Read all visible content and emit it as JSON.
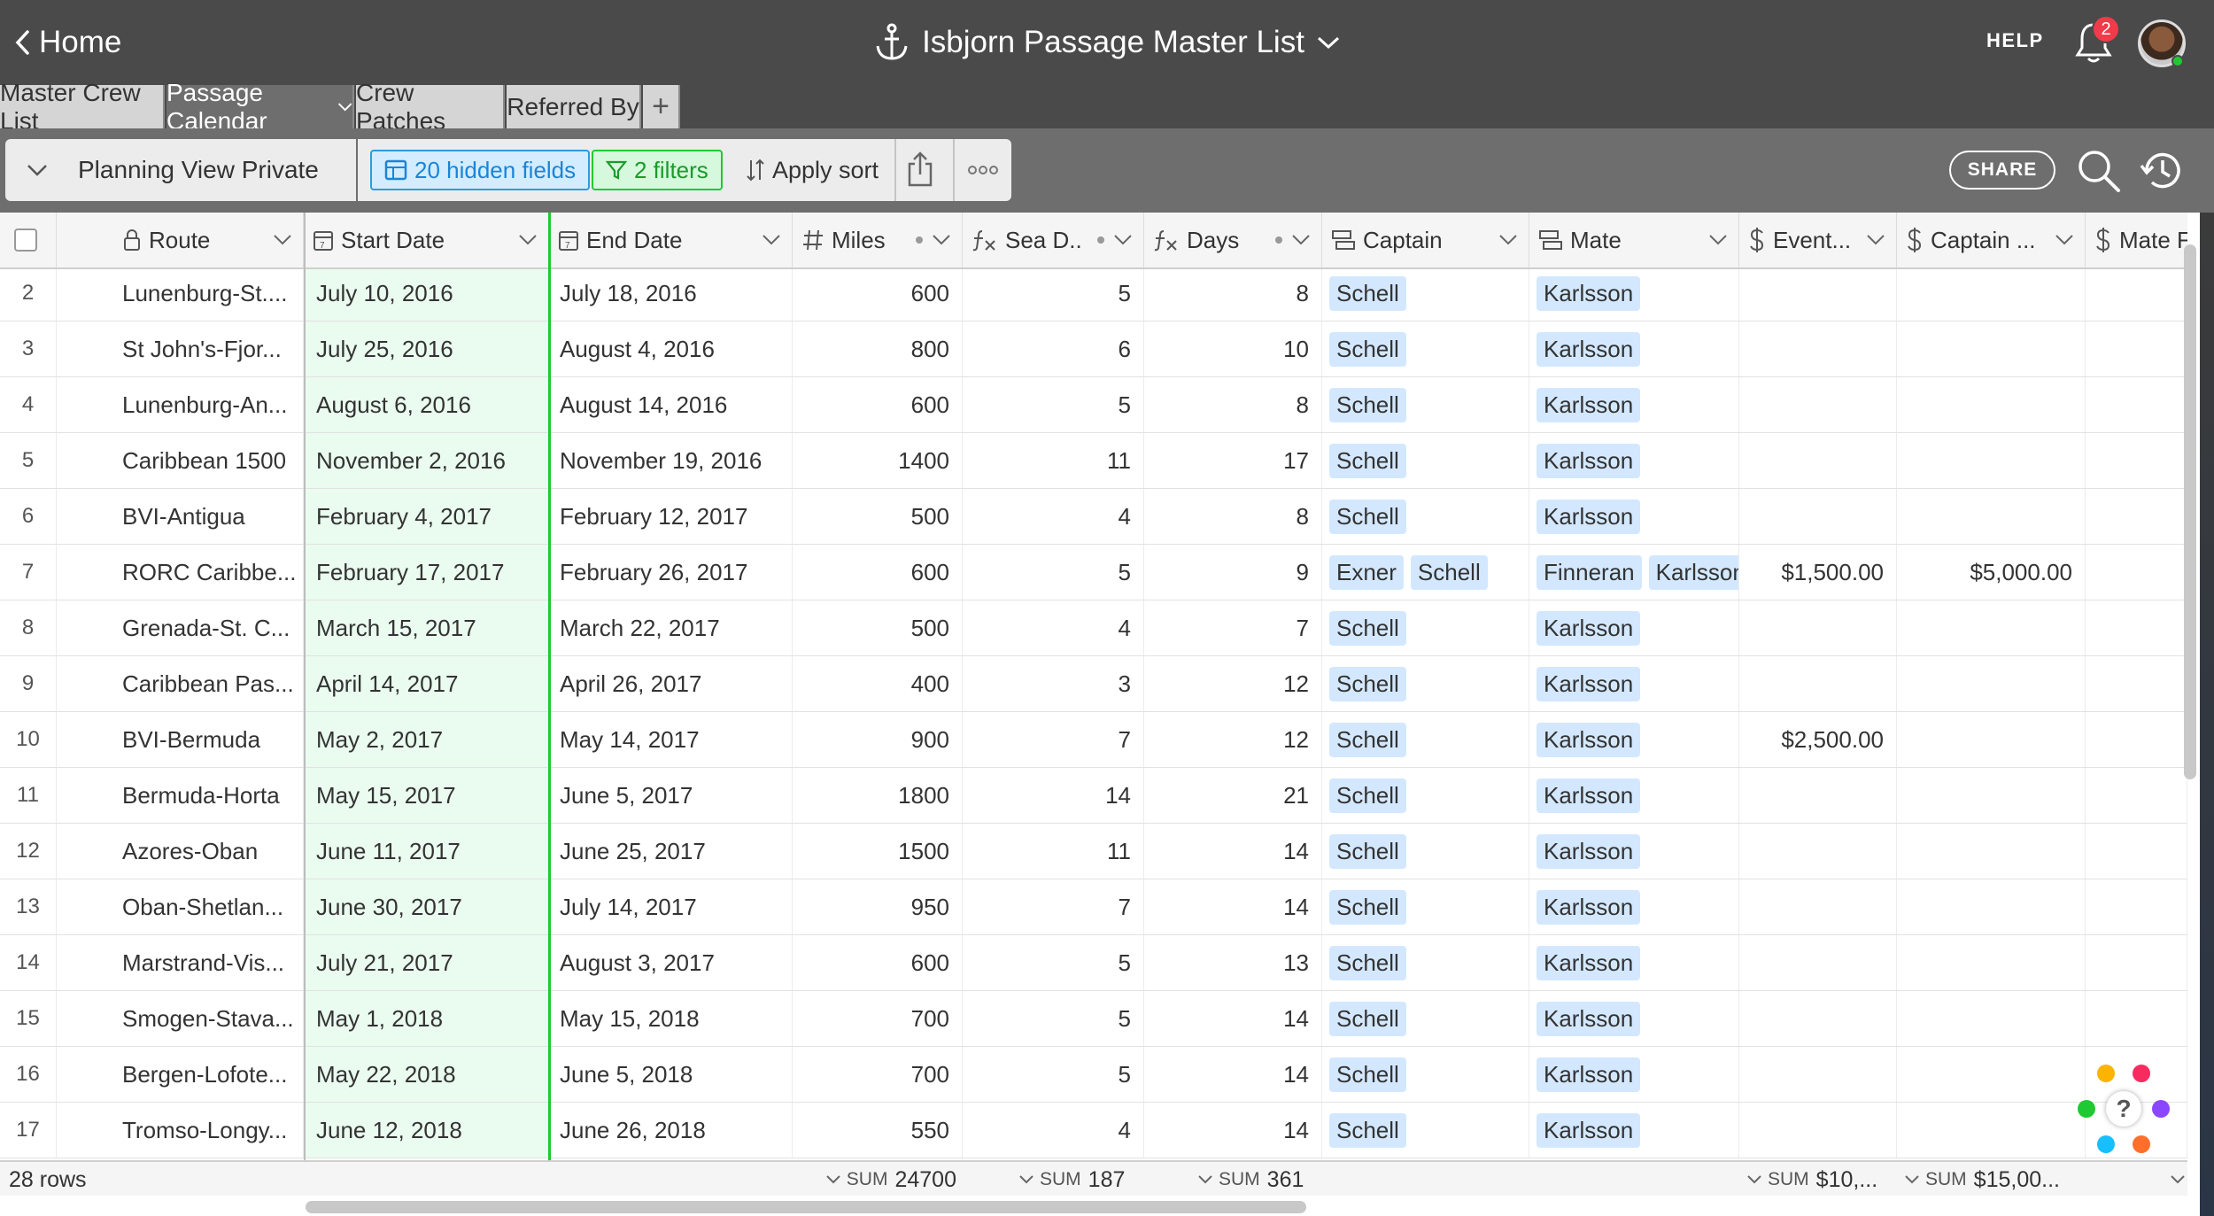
{
  "header": {
    "home_label": "Home",
    "base_title": "Isbjorn Passage Master List",
    "help_label": "HELP",
    "notification_count": "2"
  },
  "tabs": [
    {
      "label": "Master Crew List",
      "active": false
    },
    {
      "label": "Passage Calendar",
      "active": true
    },
    {
      "label": "Crew Patches",
      "active": false
    },
    {
      "label": "Referred By",
      "active": false
    }
  ],
  "add_tab_label": "+",
  "viewbar": {
    "view_name": "Planning View Private",
    "hidden_fields": "20 hidden fields",
    "filters": "2 filters",
    "sort": "Apply sort",
    "share": "SHARE"
  },
  "columns": [
    {
      "label": "Route",
      "icon": "lock-icon"
    },
    {
      "label": "Start Date",
      "icon": "calendar-icon"
    },
    {
      "label": "End Date",
      "icon": "calendar-icon"
    },
    {
      "label": "Miles",
      "icon": "number-icon"
    },
    {
      "label": "Sea D..",
      "icon": "formula-icon"
    },
    {
      "label": "Days",
      "icon": "formula-icon"
    },
    {
      "label": "Captain",
      "icon": "link-icon"
    },
    {
      "label": "Mate",
      "icon": "link-icon"
    },
    {
      "label": "Event...",
      "icon": "currency-icon"
    },
    {
      "label": "Captain ...",
      "icon": "currency-icon"
    },
    {
      "label": "Mate F...",
      "icon": "currency-icon"
    }
  ],
  "rows": [
    {
      "n": "2",
      "route": "Lunenburg-St....",
      "start": "July 10, 2016",
      "end": "July 18, 2016",
      "miles": "600",
      "sea": "5",
      "days": "8",
      "captain": [
        "Schell"
      ],
      "mate": [
        "Karlsson"
      ],
      "event": "",
      "cap_fee": ""
    },
    {
      "n": "3",
      "route": "St John's-Fjor...",
      "start": "July 25, 2016",
      "end": "August 4, 2016",
      "miles": "800",
      "sea": "6",
      "days": "10",
      "captain": [
        "Schell"
      ],
      "mate": [
        "Karlsson"
      ],
      "event": "",
      "cap_fee": ""
    },
    {
      "n": "4",
      "route": "Lunenburg-An...",
      "start": "August 6, 2016",
      "end": "August 14, 2016",
      "miles": "600",
      "sea": "5",
      "days": "8",
      "captain": [
        "Schell"
      ],
      "mate": [
        "Karlsson"
      ],
      "event": "",
      "cap_fee": ""
    },
    {
      "n": "5",
      "route": "Caribbean 1500",
      "start": "November 2, 2016",
      "end": "November 19, 2016",
      "miles": "1400",
      "sea": "11",
      "days": "17",
      "captain": [
        "Schell"
      ],
      "mate": [
        "Karlsson"
      ],
      "event": "",
      "cap_fee": ""
    },
    {
      "n": "6",
      "route": "BVI-Antigua",
      "start": "February 4, 2017",
      "end": "February 12, 2017",
      "miles": "500",
      "sea": "4",
      "days": "8",
      "captain": [
        "Schell"
      ],
      "mate": [
        "Karlsson"
      ],
      "event": "",
      "cap_fee": ""
    },
    {
      "n": "7",
      "route": "RORC Caribbe...",
      "start": "February 17, 2017",
      "end": "February 26, 2017",
      "miles": "600",
      "sea": "5",
      "days": "9",
      "captain": [
        "Exner",
        "Schell"
      ],
      "mate": [
        "Finneran",
        "Karlsson"
      ],
      "event": "$1,500.00",
      "cap_fee": "$5,000.00"
    },
    {
      "n": "8",
      "route": "Grenada-St. C...",
      "start": "March 15, 2017",
      "end": "March 22, 2017",
      "miles": "500",
      "sea": "4",
      "days": "7",
      "captain": [
        "Schell"
      ],
      "mate": [
        "Karlsson"
      ],
      "event": "",
      "cap_fee": ""
    },
    {
      "n": "9",
      "route": "Caribbean Pas...",
      "start": "April 14, 2017",
      "end": "April 26, 2017",
      "miles": "400",
      "sea": "3",
      "days": "12",
      "captain": [
        "Schell"
      ],
      "mate": [
        "Karlsson"
      ],
      "event": "",
      "cap_fee": ""
    },
    {
      "n": "10",
      "route": "BVI-Bermuda",
      "start": "May 2, 2017",
      "end": "May 14, 2017",
      "miles": "900",
      "sea": "7",
      "days": "12",
      "captain": [
        "Schell"
      ],
      "mate": [
        "Karlsson"
      ],
      "event": "$2,500.00",
      "cap_fee": ""
    },
    {
      "n": "11",
      "route": "Bermuda-Horta",
      "start": "May 15, 2017",
      "end": "June 5, 2017",
      "miles": "1800",
      "sea": "14",
      "days": "21",
      "captain": [
        "Schell"
      ],
      "mate": [
        "Karlsson"
      ],
      "event": "",
      "cap_fee": ""
    },
    {
      "n": "12",
      "route": "Azores-Oban",
      "start": "June 11, 2017",
      "end": "June 25, 2017",
      "miles": "1500",
      "sea": "11",
      "days": "14",
      "captain": [
        "Schell"
      ],
      "mate": [
        "Karlsson"
      ],
      "event": "",
      "cap_fee": ""
    },
    {
      "n": "13",
      "route": "Oban-Shetlan...",
      "start": "June 30, 2017",
      "end": "July 14, 2017",
      "miles": "950",
      "sea": "7",
      "days": "14",
      "captain": [
        "Schell"
      ],
      "mate": [
        "Karlsson"
      ],
      "event": "",
      "cap_fee": ""
    },
    {
      "n": "14",
      "route": "Marstrand-Vis...",
      "start": "July 21, 2017",
      "end": "August 3, 2017",
      "miles": "600",
      "sea": "5",
      "days": "13",
      "captain": [
        "Schell"
      ],
      "mate": [
        "Karlsson"
      ],
      "event": "",
      "cap_fee": ""
    },
    {
      "n": "15",
      "route": "Smogen-Stava...",
      "start": "May 1, 2018",
      "end": "May 15, 2018",
      "miles": "700",
      "sea": "5",
      "days": "14",
      "captain": [
        "Schell"
      ],
      "mate": [
        "Karlsson"
      ],
      "event": "",
      "cap_fee": ""
    },
    {
      "n": "16",
      "route": "Bergen-Lofote...",
      "start": "May 22, 2018",
      "end": "June 5, 2018",
      "miles": "700",
      "sea": "5",
      "days": "14",
      "captain": [
        "Schell"
      ],
      "mate": [
        "Karlsson"
      ],
      "event": "",
      "cap_fee": ""
    },
    {
      "n": "17",
      "route": "Tromso-Longy...",
      "start": "June 12, 2018",
      "end": "June 26, 2018",
      "miles": "550",
      "sea": "4",
      "days": "14",
      "captain": [
        "Schell"
      ],
      "mate": [
        "Karlsson"
      ],
      "event": "",
      "cap_fee": ""
    }
  ],
  "footer": {
    "row_count": "28 rows",
    "sum_label": "SUM",
    "miles_sum": "24700",
    "sea_sum": "187",
    "days_sum": "361",
    "event_sum": "$10,...",
    "captain_fee_sum": "$15,00..."
  },
  "colors": {
    "topbar": "#4a4a4a",
    "hidden_fields_accent": "#2d9cdb",
    "filters_accent": "#20c933",
    "link_pill": "#d3e8ff",
    "notification_badge": "#ef3b4a"
  },
  "icons": {
    "back": "chevron-left-icon",
    "base": "anchor-icon",
    "notifications": "bell-icon",
    "search": "search-icon",
    "history": "history-icon",
    "share": "share-icon",
    "more": "more-icon",
    "help": "help-question-icon"
  }
}
